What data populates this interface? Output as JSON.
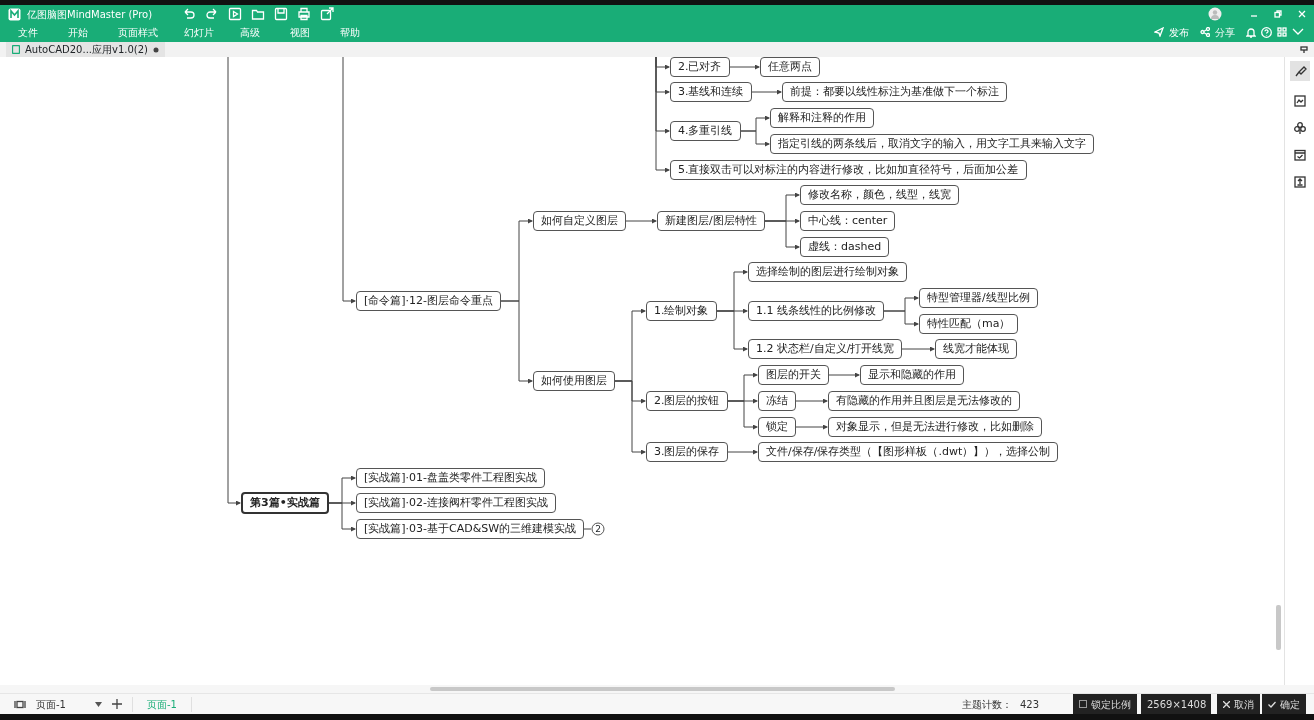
{
  "window": {
    "title": "亿图脑图MindMaster (Pro)"
  },
  "menu": [
    "文件",
    "开始",
    "页面样式",
    "幻灯片",
    "高级",
    "视图",
    "帮助"
  ],
  "header_actions": [
    "发布",
    "分享"
  ],
  "document_tab": {
    "label": "AutoCAD20...应用v1.0(2)",
    "unsaved": true
  },
  "mindmap": {
    "branches": [
      {
        "children": [
          {
            "text": "2.已对齐",
            "children": [
              {
                "text": "任意两点"
              }
            ]
          },
          {
            "text": "3.基线和连续",
            "children": [
              {
                "text": "前提：都要以线性标注为基准做下一个标注"
              }
            ]
          },
          {
            "text": "4.多重引线",
            "children": [
              {
                "text": "解释和注释的作用"
              },
              {
                "text": "指定引线的两条线后，取消文字的输入，用文字工具来输入文字"
              }
            ]
          },
          {
            "text": "5.直接双击可以对标注的内容进行修改，比如加直径符号，后面加公差"
          }
        ]
      },
      {
        "children": [
          {
            "text": "[命令篇]·12-图层命令重点",
            "children": [
              {
                "text": "如何自定义图层",
                "children": [
                  {
                    "text": "新建图层/图层特性",
                    "children": [
                      {
                        "text": "修改名称，颜色，线型，线宽"
                      },
                      {
                        "text": "中心线：center"
                      },
                      {
                        "text": "虚线：dashed"
                      }
                    ]
                  }
                ]
              },
              {
                "text": "如何使用图层",
                "children": [
                  {
                    "text": "1.绘制对象",
                    "children": [
                      {
                        "text": "选择绘制的图层进行绘制对象"
                      },
                      {
                        "text": "1.1 线条线性的比例修改",
                        "children": [
                          {
                            "text": "特型管理器/线型比例"
                          },
                          {
                            "text": "特性匹配（ma）"
                          }
                        ]
                      },
                      {
                        "text": "1.2 状态栏/自定义/打开线宽",
                        "children": [
                          {
                            "text": "线宽才能体现"
                          }
                        ]
                      }
                    ]
                  },
                  {
                    "text": "2.图层的按钮",
                    "children": [
                      {
                        "text": "图层的开关",
                        "children": [
                          {
                            "text": "显示和隐藏的作用"
                          }
                        ]
                      },
                      {
                        "text": "冻结",
                        "children": [
                          {
                            "text": "有隐藏的作用并且图层是无法修改的"
                          }
                        ]
                      },
                      {
                        "text": "锁定",
                        "children": [
                          {
                            "text": "对象显示，但是无法进行修改，比如删除"
                          }
                        ]
                      }
                    ]
                  },
                  {
                    "text": "3.图层的保存",
                    "children": [
                      {
                        "text": "文件/保存/保存类型（【图形样板（.dwt）】），选择公制"
                      }
                    ]
                  }
                ]
              }
            ]
          }
        ]
      },
      {
        "children": [
          {
            "text": "第3篇•实战篇",
            "emphasis": true,
            "children": [
              {
                "text": "[实战篇]·01-盘盖类零件工程图实战"
              },
              {
                "text": "[实战篇]·02-连接阀杆零件工程图实战"
              },
              {
                "text": "[实战篇]·03-基于CAD&SW的三维建模实战",
                "hidden_count": "2"
              }
            ]
          }
        ]
      }
    ]
  },
  "status_bar": {
    "page_select": "页面-1",
    "pages": [
      {
        "label": "页面-1",
        "selected": true
      }
    ],
    "topic_count_label": "主题计数：",
    "topic_count": "423"
  },
  "capture_toolbar": {
    "lock_ratio": {
      "label": "锁定比例",
      "checked": false
    },
    "size": "2569×1408",
    "cancel": "取消",
    "confirm": "确定"
  }
}
